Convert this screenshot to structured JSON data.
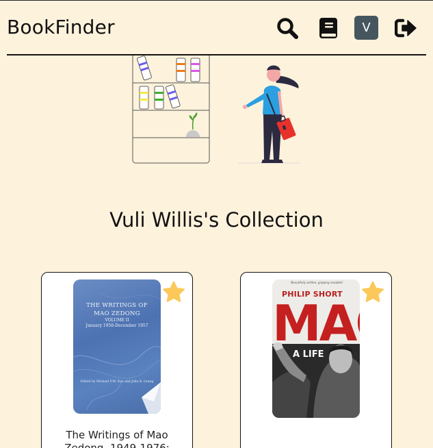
{
  "nav": {
    "brand": "BookFinder",
    "avatar_letter": "V"
  },
  "icons": [
    "search-icon",
    "book-icon",
    "logout-icon",
    "star-icon"
  ],
  "colors": {
    "background": "#fdf2dc",
    "avatar_bg": "#45565f",
    "star": "#fcc85a",
    "card_bg": "#ffffff"
  },
  "collection": {
    "title": "Vuli Willis's Collection",
    "books": [
      {
        "cover_title": "THE WRITINGS OF MAO ZEDONG",
        "cover_volume": "VOLUME II",
        "cover_dates": "January 1956-December 1957",
        "cover_editors": "Edited by Michael Y.M. Kau and John K. Leung",
        "title": "The Writings of Mao Zedong, 1949-1976:",
        "favorite": true
      },
      {
        "cover_tagline": "'Beautifully written, gripping readable'",
        "cover_author": "PHILIP SHORT",
        "cover_title": "MAO",
        "cover_subtitle": "A LIFE",
        "title": "",
        "favorite": true
      }
    ]
  }
}
